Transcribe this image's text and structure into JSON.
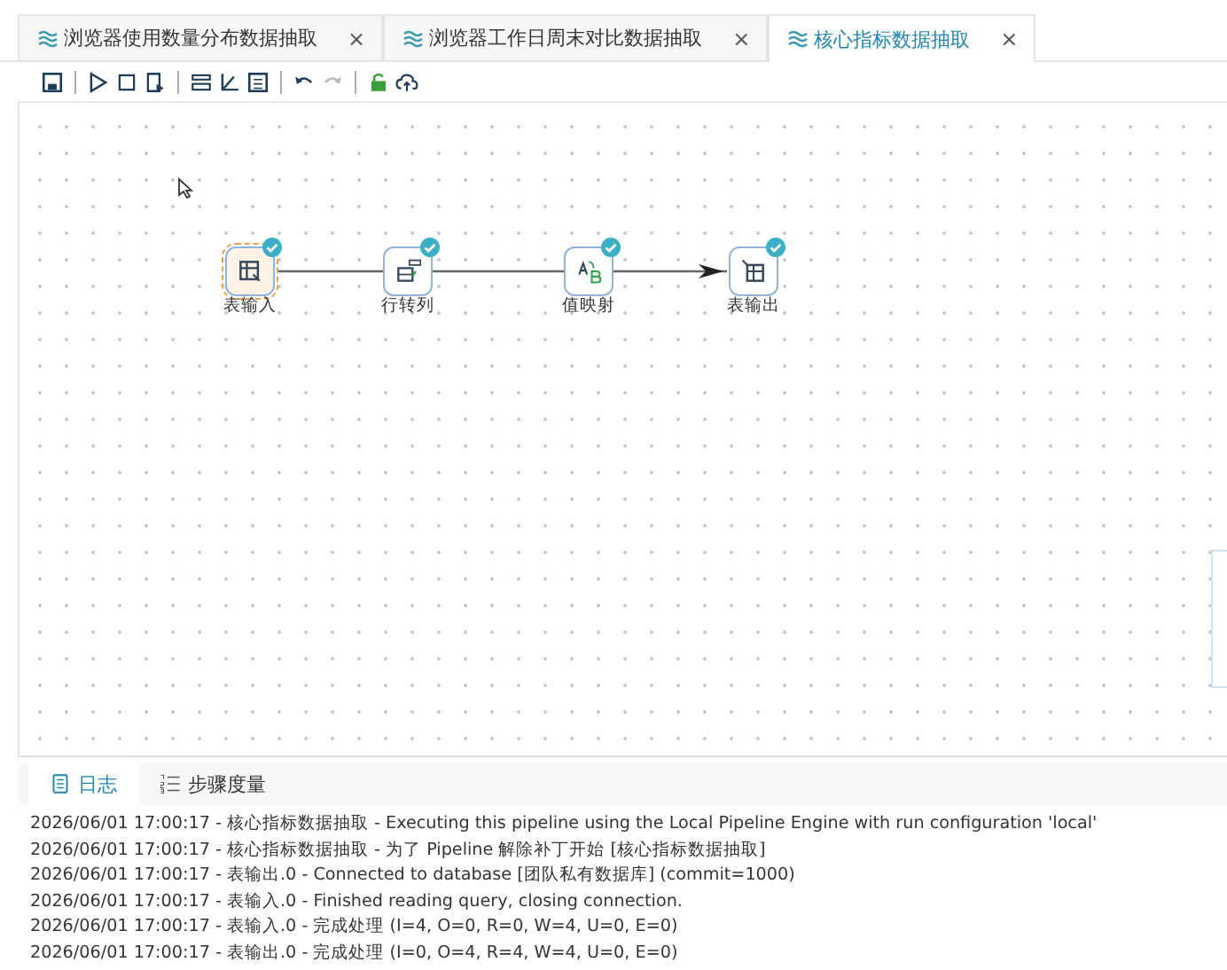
{
  "tabs": [
    {
      "label": "浏览器使用数量分布数据抽取",
      "close": "×",
      "selected": false
    },
    {
      "label": "浏览器工作日周末对比数据抽取",
      "close": "×",
      "selected": false
    },
    {
      "label": "核心指标数据抽取",
      "close": "×",
      "selected": true
    }
  ],
  "toolbar": [
    {
      "kind": "save",
      "disabled": false
    },
    {
      "kind": "sep"
    },
    {
      "kind": "run",
      "disabled": false
    },
    {
      "kind": "stop",
      "disabled": false
    },
    {
      "kind": "preview",
      "disabled": false
    },
    {
      "kind": "sep"
    },
    {
      "kind": "grid",
      "disabled": false
    },
    {
      "kind": "chart",
      "disabled": false
    },
    {
      "kind": "table",
      "disabled": false
    },
    {
      "kind": "sep"
    },
    {
      "kind": "undo",
      "disabled": false
    },
    {
      "kind": "redo",
      "disabled": true
    },
    {
      "kind": "sep"
    },
    {
      "kind": "lock",
      "disabled": false
    },
    {
      "kind": "upload",
      "disabled": false
    }
  ],
  "canvas": {
    "nodes": [
      {
        "kind": "table-input",
        "label": "表输入",
        "selected": true,
        "checked": true
      },
      {
        "kind": "row-to-col",
        "label": "行转列",
        "selected": false,
        "checked": true
      },
      {
        "kind": "value-map",
        "label": "值映射",
        "selected": false,
        "checked": true
      },
      {
        "kind": "table-output",
        "label": "表输出",
        "selected": false,
        "checked": true
      }
    ]
  },
  "bottom_tabs": [
    {
      "kind": "log",
      "label": "日志",
      "selected": true
    },
    {
      "kind": "metrics",
      "label": "步骤度量",
      "selected": false
    }
  ],
  "log_lines": [
    "2026/06/01 17:00:17 - 核心指标数据抽取 - Executing this pipeline using the Local Pipeline Engine with run configuration 'local'",
    "2026/06/01 17:00:17 - 核心指标数据抽取 - 为了 Pipeline 解除补丁开始 [核心指标数据抽取]",
    "2026/06/01 17:00:17 - 表输出.0 - Connected to database [团队私有数据库] (commit=1000)",
    "2026/06/01 17:00:17 - 表输入.0 - Finished reading query, closing connection.",
    "2026/06/01 17:00:17 - 表输入.0 - 完成处理 (I=4, O=0, R=0, W=4, U=0, E=0)",
    "2026/06/01 17:00:17 - 表输出.0 - 完成处理 (I=0, O=4, R=4, W=4, U=0, E=0)"
  ]
}
